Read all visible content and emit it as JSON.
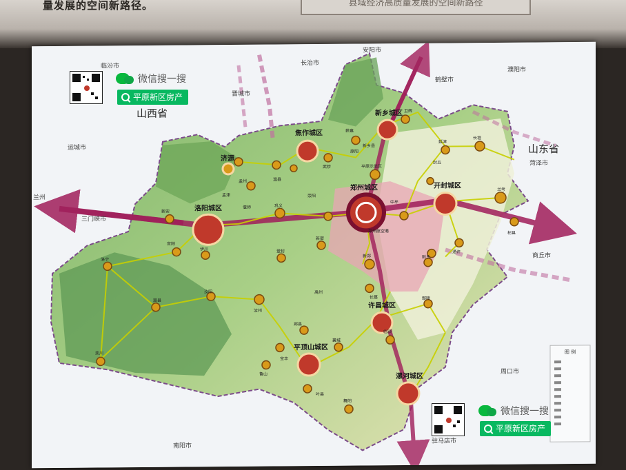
{
  "header": {
    "top_text": "量发展的空间新路径。",
    "banner_text": "县域经济高质量发展的空间新路径"
  },
  "watermarks": [
    {
      "label": "微信搜一搜",
      "search": "平原新区房产"
    },
    {
      "label": "微信搜一搜",
      "search": "平原新区房产"
    }
  ],
  "colors": {
    "main_corridor": "#a01e5a",
    "city_fill": "#c0392b",
    "node_fill": "#d99a1a",
    "connector": "#c8d000",
    "core_zone": "#e8a6b4"
  },
  "provinces": [
    "山西省",
    "山东省"
  ],
  "outside_cities": [
    "临汾市",
    "晋城市",
    "运城市",
    "三门峡市",
    "安阳市",
    "濮阳市",
    "鹤壁市",
    "菏泽市",
    "商丘市",
    "周口市",
    "南阳市",
    "驻马店市",
    "兰州",
    "长治市"
  ],
  "major_cities": [
    "郑州城区",
    "洛阳城区",
    "开封城区",
    "新乡城区",
    "焦作城区",
    "许昌城区",
    "平顶山城区",
    "漯河城区",
    "济源"
  ],
  "minor_nodes": [
    "孟州",
    "温县",
    "武陟",
    "原阳",
    "获嘉",
    "新乡县",
    "卫辉",
    "延津",
    "长垣",
    "封丘",
    "兰考",
    "杞县",
    "通许",
    "尉氏",
    "长葛",
    "禹州",
    "襄城",
    "郏县",
    "宝丰",
    "鲁山",
    "叶县",
    "舞阳",
    "临颍",
    "鄢陵",
    "汝阳",
    "汝州",
    "伊川",
    "宜阳",
    "新安",
    "偃师",
    "巩义",
    "荥阳",
    "新郑",
    "新密",
    "登封",
    "中牟",
    "嵩县",
    "栾川",
    "洛宁",
    "孟津",
    "平原示范区"
  ],
  "map_labels": {
    "airport": "郑州航空港",
    "legend_title": "图 例"
  }
}
